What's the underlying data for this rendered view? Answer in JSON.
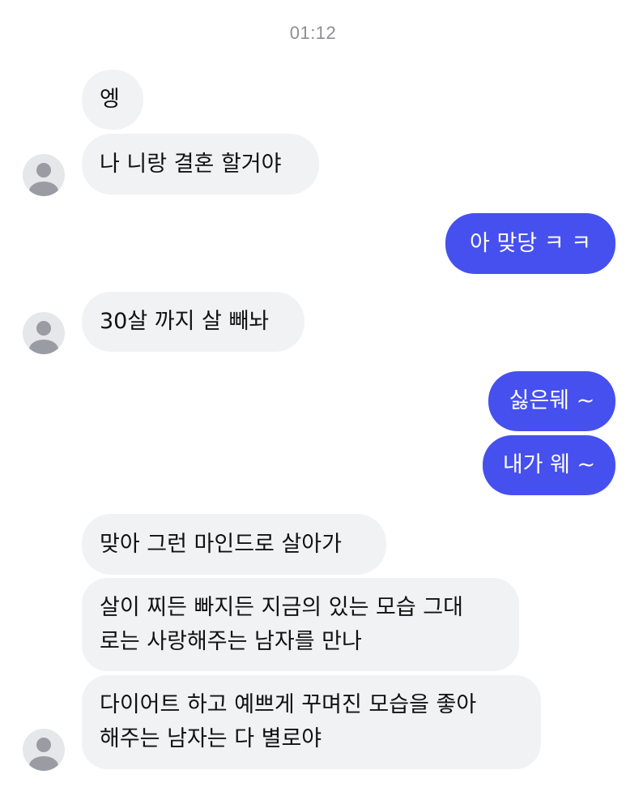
{
  "chat": {
    "timestamp": "01:12",
    "messages": [
      {
        "sender": "other",
        "text": "엥"
      },
      {
        "sender": "other",
        "text": "나 니랑 결혼 할거야"
      },
      {
        "sender": "me",
        "text": "아 맞당 ㅋ ㅋ"
      },
      {
        "sender": "other",
        "text": "30살 까지 살 빼놔"
      },
      {
        "sender": "me",
        "text": "싫은뒈 ~"
      },
      {
        "sender": "me",
        "text": "내가 웨 ~"
      },
      {
        "sender": "other",
        "text": "맞아 그런 마인드로 살아가"
      },
      {
        "sender": "other",
        "lines": [
          "살이 찌든 빠지든 지금의 있는 모습 그대",
          "로는 사랑해주는 남자를 만나"
        ]
      },
      {
        "sender": "other",
        "lines": [
          "다이어트 하고 예쁘게 꾸며진 모습을 좋아",
          "해주는 남자는 다 별로야"
        ]
      }
    ]
  },
  "icons": {
    "avatar": "default-profile-icon"
  },
  "colors": {
    "incoming_bubble": "#f1f2f4",
    "outgoing_bubble": "#4650ee",
    "timestamp": "#8e8e93",
    "avatar_bg": "#e6e7ea",
    "avatar_figure": "#9a9ca3"
  }
}
